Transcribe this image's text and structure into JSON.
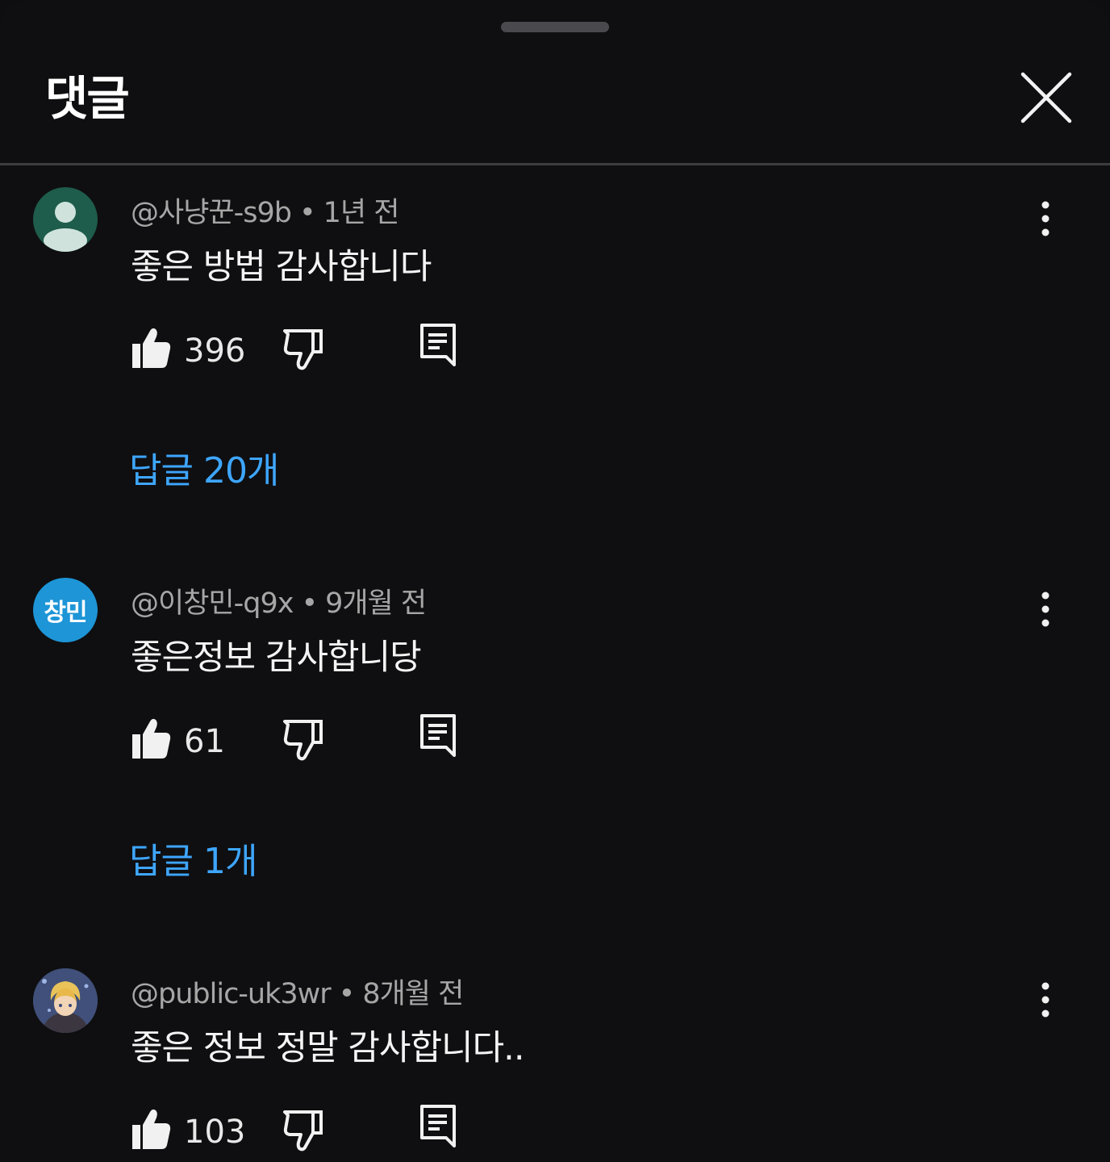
{
  "header": {
    "title": "댓글",
    "close_icon": "close-icon"
  },
  "colors": {
    "background": "#0f0f11",
    "link": "#3ea6ff",
    "meta": "#a6a6a6"
  },
  "comments": [
    {
      "author": "@사냥꾼-s9b",
      "time": "1년 전",
      "text": "좋은 방법 감사합니다",
      "likes": "396",
      "replies": "답글 20개",
      "avatar": "default-user-icon"
    },
    {
      "author": "@이창민-q9x",
      "time": "9개월 전",
      "text": "좋은정보 감사합니당",
      "likes": "61",
      "replies": "답글 1개",
      "avatar_text": "창민"
    },
    {
      "author": "@public-uk3wr",
      "time": "8개월 전",
      "text": "좋은 정보 정말 감사합니다..",
      "likes": "103",
      "avatar": "character-image"
    }
  ]
}
